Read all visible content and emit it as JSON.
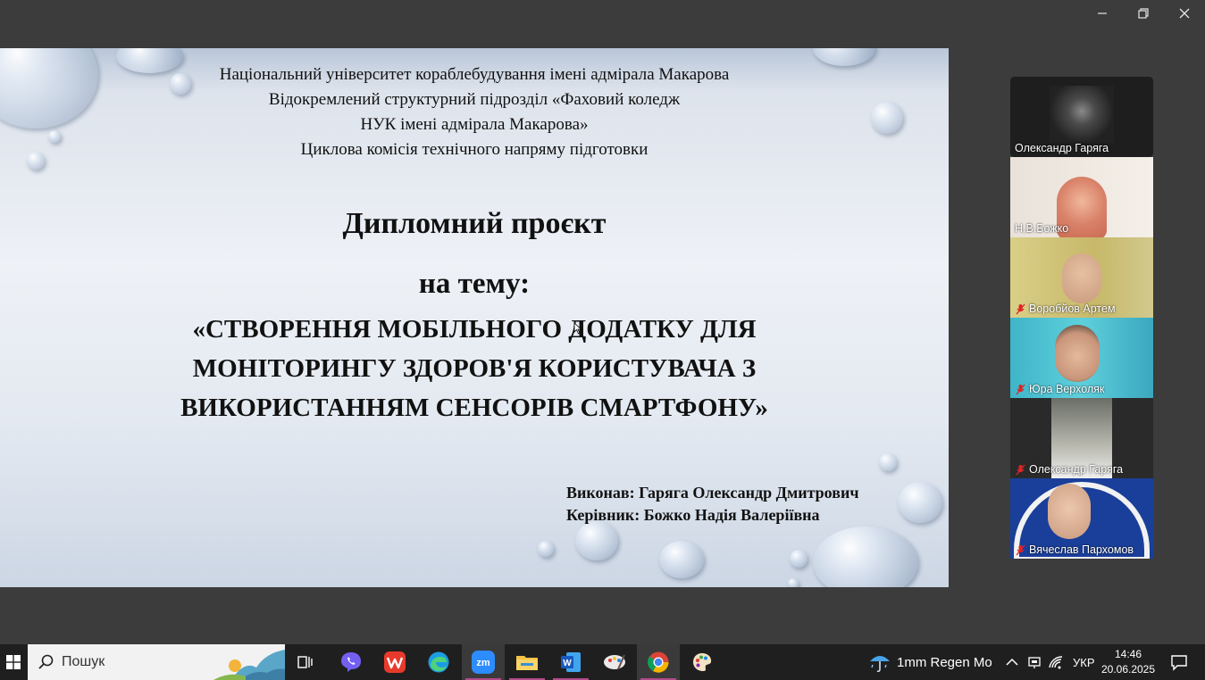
{
  "slide": {
    "header": [
      "Національний університет кораблебудування  імені адмірала Макарова",
      "Відокремлений структурний підрозділ «Фаховий коледж",
      "НУК імені адмірала Макарова»",
      "Циклова комісія  технічного напряму підготовки"
    ],
    "title": "Дипломний проєкт",
    "subtitle": "на тему:",
    "topic": [
      "«СТВОРЕННЯ МОБІЛЬНОГО ДОДАТКУ ДЛЯ",
      "МОНІТОРИНГУ ЗДОРОВ'Я КОРИСТУВАЧА З",
      "ВИКОРИСТАННЯМ СЕНСОРІВ СМАРТФОНУ»"
    ],
    "author_line": "Виконав: Гаряга  Олександр Дмитрович",
    "supervisor_line": "Керівник: Божко Надія Валеріївна"
  },
  "participants": [
    {
      "name": "Олександр Гаряга",
      "muted": false,
      "active": true
    },
    {
      "name": "Н.В.Божко",
      "muted": false,
      "active": false
    },
    {
      "name": "Воробйов Артем",
      "muted": true,
      "active": false
    },
    {
      "name": "Юра Верхоляк",
      "muted": true,
      "active": false
    },
    {
      "name": "Олександр Гаряга",
      "muted": true,
      "active": false
    },
    {
      "name": "Вячеслав Пархомов",
      "muted": true,
      "active": false
    }
  ],
  "taskbar": {
    "search_placeholder": "Пошук",
    "weather": "1mm Regen Mo",
    "language": "УКР",
    "time": "14:46",
    "date": "20.06.2025"
  },
  "colors": {
    "active_speaker": "#2fd39a",
    "taskbar": "#1f1f1f",
    "background": "#3c3c3c",
    "mic_muted": "#e02424"
  }
}
